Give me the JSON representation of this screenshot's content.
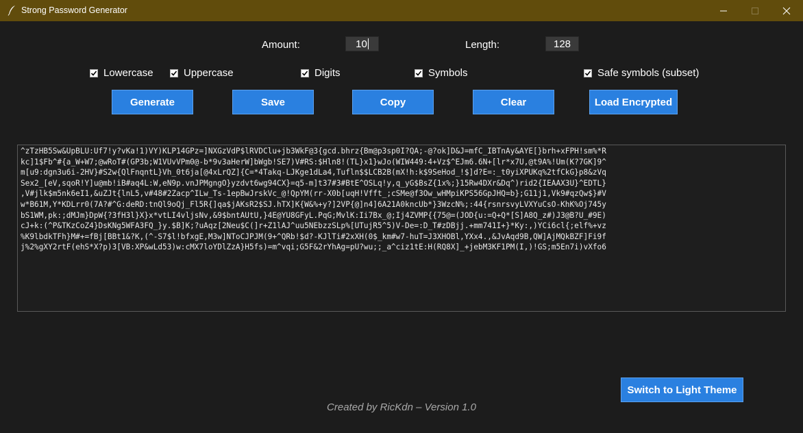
{
  "window": {
    "title": "Strong Password Generator",
    "icon": "feather-pen-icon"
  },
  "settings": {
    "amount_label": "Amount:",
    "amount_value": "10",
    "length_label": "Length:",
    "length_value": "128"
  },
  "options": [
    {
      "label": "Lowercase",
      "checked": true
    },
    {
      "label": "Uppercase",
      "checked": true
    },
    {
      "label": "Digits",
      "checked": true
    },
    {
      "label": "Symbols",
      "checked": true
    },
    {
      "label": "Safe symbols (subset)",
      "checked": true
    }
  ],
  "buttons": {
    "generate": "Generate",
    "save": "Save",
    "copy": "Copy",
    "clear": "Clear",
    "load_encrypted": "Load Encrypted"
  },
  "output": {
    "lines": [
      "^zTzHB5Sw&UpBLU:Uf7!y?vKa!1)VY)KLP14GPz=]NXGzVdP$lRVDClu+jb3WkF@3{gcd.bhrz{Bm@p3sp0I?QA;-@?ok]D&J=mfC_IBTnAy&AYE[}brh+xFPH!sm%*R",
      "kc]1$Fb^#{a_W+W7;@wRoT#(GP3b;W1VUvVPm0@-b*9v3aHerW]bWgb!SE7)V#RS:$Hln8!(TL}x1}wJo(WIW449:4+Vz$^EJm6.6N+[lr*x7U,@t9A%!Um(K?7GK]9^",
      "m[u9:dgn3u6i-2HV}#S2w{QlFnqntL}Vh_0t6ja[@4xLrQZ]{C=*4Takq-LJKge1dLa4,Tufln$$LCB2B(mX!h:k$9SeHod_!$]d?E=:_t0yiXPUKq%2tfCkG}p8&zVq",
      "Sex2_[eV,sqoR!Y]u@mb!iB#aq4L:W,eN9p.vnJPMgngO}yzdvt6wg94CX}=q5-m]t37#3#BtE^OSLq!y,q_yG$BsZ{1x%;}15Rw4DXr&Dq^)rid2{IEAAX3U}^EDTL}",
      ",V#jlk$m5nk6eI1,&uZJt{lnL5,v#48#2Zacp^ILw_Ts-1epBwJrskVc_@!QpYM(rr-X0b[uqH!Vfft_;cSMe@f3Ow_wHMpiKPS56GpJHQ=b};G11j1,Vk9#qzQw$}#V",
      "w*B61M,Y*KDLrr0(7A?#^G:deRD:tnQl9oQj_Fl5R{]qa$jAKsR2$SJ.hTX]K{W&%+y?]2VP{@]n4]6A21A0kncUb*}3WzcN%;:44{rsnrsvyLVXYuCsO-KhK%Oj745y",
      "bS1WM,pk:;dMJm}DpW{?3fH3l}X}x*vtLI4vljsNv,&9$bntAUtU,}4E@YU8GFyL.PqG;MvlK:Ii7Bx_@;Ij4ZVMP{{75@=(JOD{u:=Q+Q*[S]A8Q_z#)J3@B?U_#9E)",
      "cJ+k:(^P&TKzCoZ4}DsKNg5WFA3FQ_}y.$B]K;?uAqz[2Neu$C(]r+Z1lAJ^uu5NEbzzSLp%[UTujR5^5)V-De=:D_T#zDBjj.+mm741I+}*Ky:,)YCi6cl{;elf%+vz",
      "%K9lbdkTFh}M#+=fBj[BBt1&?K,(^-S7$l!bfxgE,M3w]NToCJPJM(9+^QRb!$d?-KJlTi#2xXH(0$_km#w7-huT=J3XHOBl,YXx4.,&JvAqd9B,QW]AjMQkBZF]Fi9f",
      "j%2%gXY2rtF(ehS*X?p)3[VB:XP&wLd53)w:cMX7loYDlZzA}H5fs)=m^vqi;G5F&2rYhAg=pU?wu;;_a^ciz1tE:H(RQ8X]_+jebM3KF1PM(I,)!GS;m5En7i)vXfo6"
    ]
  },
  "theme_button": "Switch to Light Theme",
  "footer": "Created by RicKdn – Version 1.0"
}
